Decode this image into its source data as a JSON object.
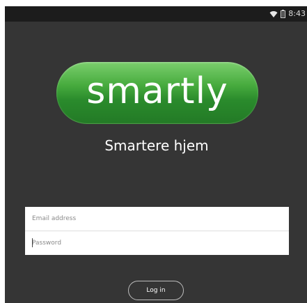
{
  "status_bar": {
    "time": "8:43",
    "icons": [
      "wifi-icon",
      "battery-icon"
    ]
  },
  "logo": {
    "text": "smartly"
  },
  "tagline": "Smartere hjem",
  "form": {
    "email_placeholder": "Email address",
    "email_value": "",
    "password_placeholder": "Password",
    "password_value": ""
  },
  "login_button": {
    "label": "Log in"
  },
  "colors": {
    "background": "#353535",
    "status_bar": "#1c1c1c",
    "logo_green": "#2f9a33",
    "input_background": "#ffffff",
    "button_border": "#bdbdbd"
  }
}
